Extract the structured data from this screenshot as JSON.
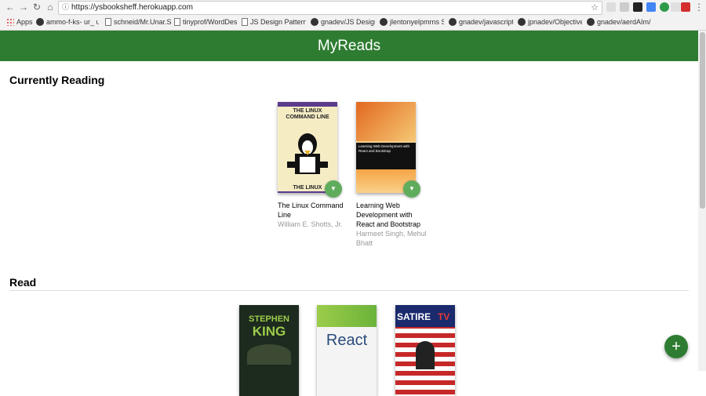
{
  "browser": {
    "url": "https://ysbooksheff.herokuapp.com",
    "bookmarks": [
      {
        "label": "Apps",
        "kind": "apps"
      },
      {
        "label": "ammo-f-ks- ur_ ucachol-c",
        "kind": "github"
      },
      {
        "label": "schneid/Mr.Unar.Sc",
        "kind": "file"
      },
      {
        "label": "tinyprof/WordDesign",
        "kind": "file"
      },
      {
        "label": "JS Design Patterns",
        "kind": "file"
      },
      {
        "label": "gnadev/JS Design Patt",
        "kind": "github"
      },
      {
        "label": "jlentonyelpmrns Sm",
        "kind": "github"
      },
      {
        "label": "gnadev/javascript-ea",
        "kind": "github"
      },
      {
        "label": "jpnadev/ObjectiveJs",
        "kind": "github"
      },
      {
        "label": "gnadev/aerdAIm/...",
        "kind": "github"
      }
    ]
  },
  "app": {
    "title": "MyReads"
  },
  "shelves": [
    {
      "title": "Currently Reading",
      "books": [
        {
          "title": "The Linux Command Line",
          "authors": "William E. Shotts, Jr.",
          "cover_bg": "#f5ecc4"
        },
        {
          "title": "Learning Web Development with React and Bootstrap",
          "authors": "Harmeet Singh, Mehul Bhatt",
          "cover_bg": "#e08a2a"
        }
      ]
    },
    {
      "title": "Read",
      "books": [
        {
          "title": "",
          "authors": "",
          "cover_bg": "#1d2a1e"
        },
        {
          "title": "",
          "authors": "",
          "cover_bg": "#f4f4f4"
        },
        {
          "title": "",
          "authors": "",
          "cover_bg": "#1a2a6c"
        }
      ]
    }
  ],
  "covers": {
    "linux_top": "THE LINUX",
    "linux_mid": "COMMAND LINE",
    "linux_bottom": "THE LINUX",
    "react_title": "Learning Web Development with React and Bootstrap",
    "king_author": "STEPHEN",
    "king_author2": "KING",
    "react_word": "React",
    "satire": "SATIRE",
    "satire_tv": "TV"
  },
  "colors": {
    "header_green": "#2e7c31",
    "changer_green": "#60ac5d"
  }
}
